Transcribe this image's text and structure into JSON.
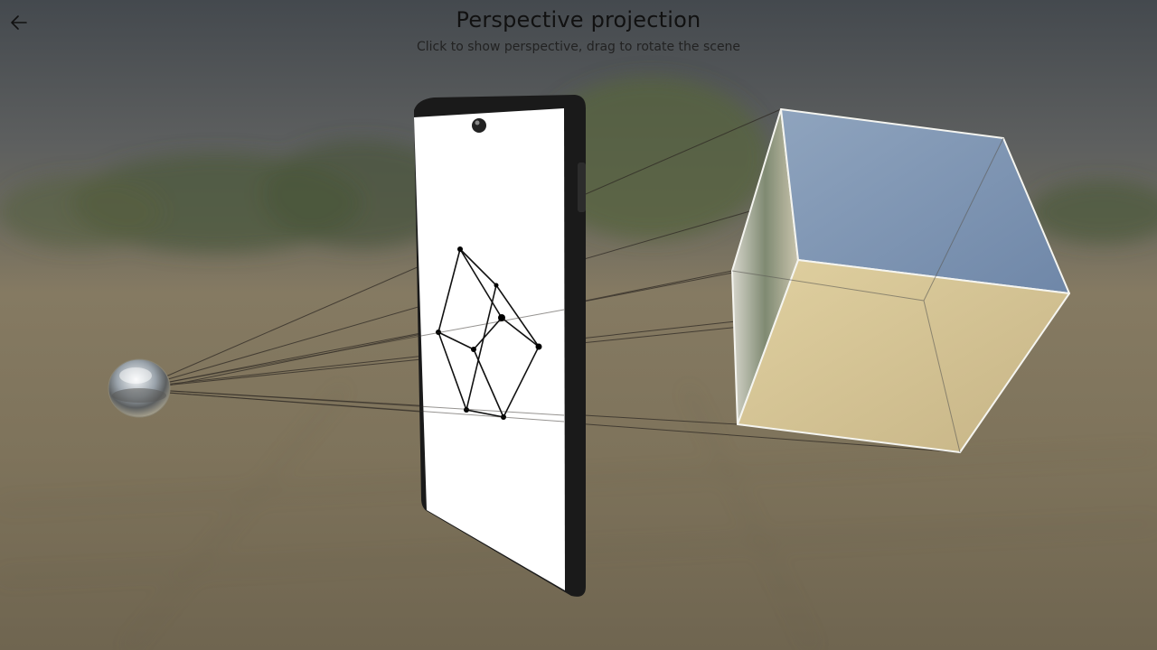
{
  "header": {
    "title": "Perspective projection",
    "subtitle": "Click to show perspective, drag to rotate the scene",
    "back_icon": "arrow-left-icon"
  },
  "colors": {
    "sky_top": "#4c5055",
    "sky_mid": "#6e6a5f",
    "ground": "#8b7f64",
    "ground_dark": "#6a604b",
    "cube_top": "#7f96b4",
    "cube_side_light": "#cdbd92",
    "cube_side_dark": "#b3a57f",
    "phone_body": "#1e1e1e",
    "phone_screen": "#ffffff",
    "projection_lines": "#3a3530"
  },
  "scene_objects": {
    "eye": "reflective-sphere",
    "screen": "phone",
    "subject": "cube"
  }
}
